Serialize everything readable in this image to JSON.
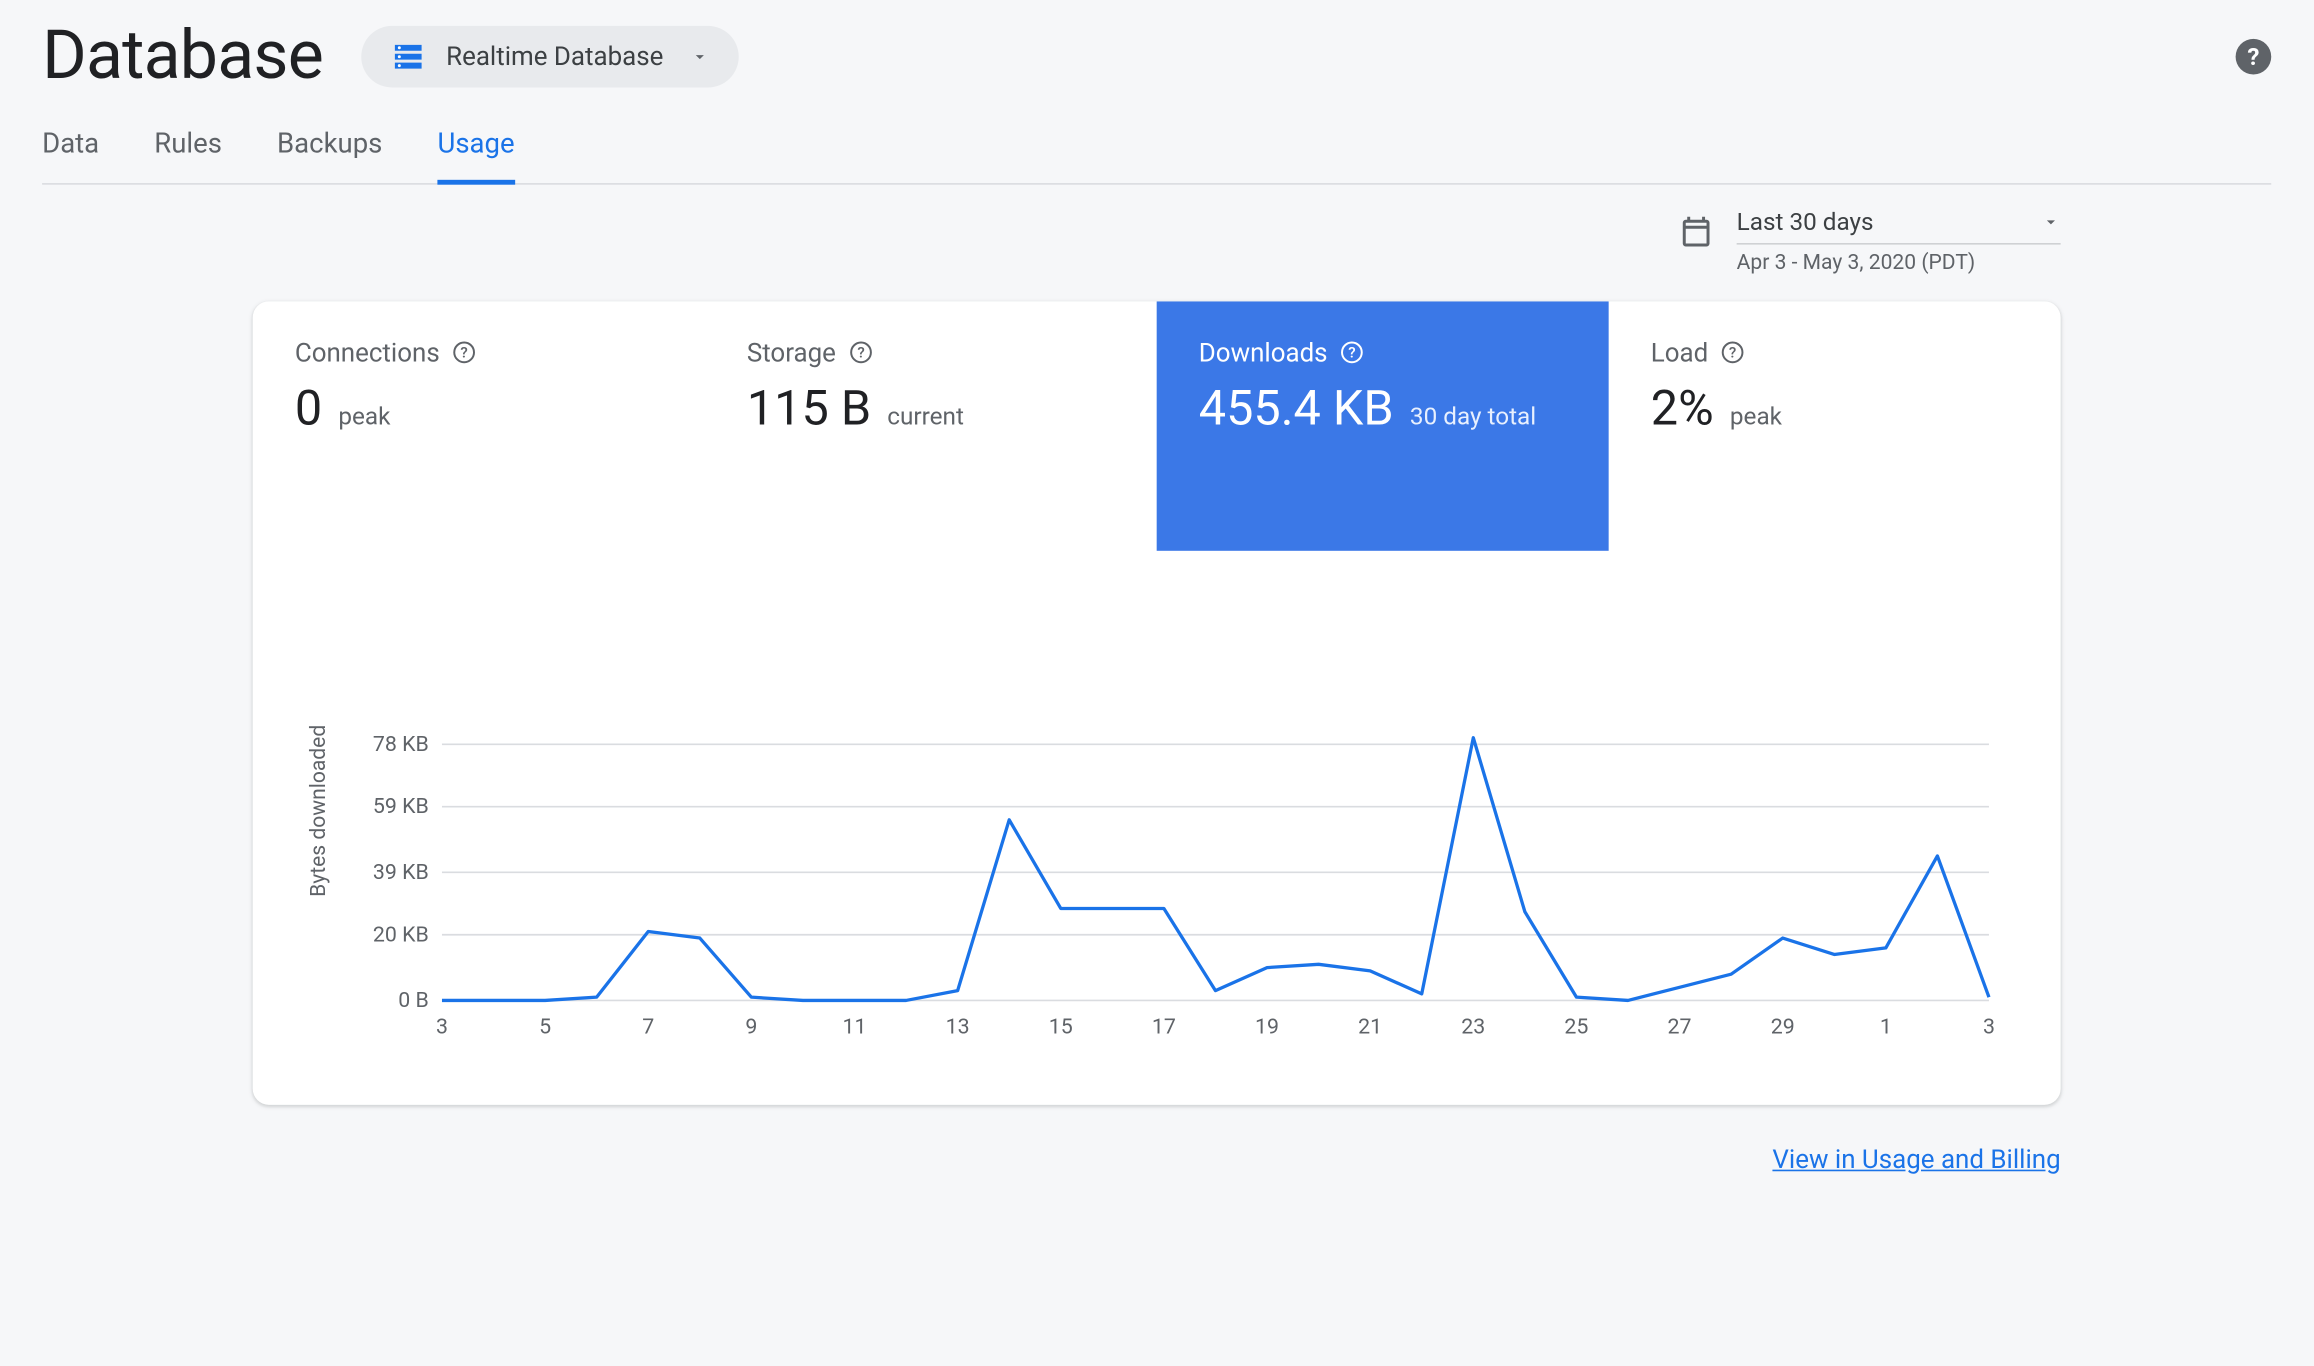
{
  "header": {
    "title": "Database",
    "selector_label": "Realtime Database"
  },
  "tabs": [
    "Data",
    "Rules",
    "Backups",
    "Usage"
  ],
  "active_tab": "Usage",
  "date_selector": {
    "label": "Last 30 days",
    "range": "Apr 3 - May 3, 2020 (PDT)"
  },
  "metrics": {
    "connections": {
      "label": "Connections",
      "value": "0",
      "suffix": "peak"
    },
    "storage": {
      "label": "Storage",
      "value": "115 B",
      "suffix": "current"
    },
    "downloads": {
      "label": "Downloads",
      "value": "455.4 KB",
      "suffix": "30 day total"
    },
    "load": {
      "label": "Load",
      "value": "2%",
      "suffix": "peak"
    }
  },
  "active_metric": "downloads",
  "chart_data": {
    "type": "line",
    "title": "",
    "ylabel": "Bytes downloaded",
    "xlabel": "",
    "ylim": [
      0,
      80
    ],
    "y_ticks": [
      "0 B",
      "20 KB",
      "39 KB",
      "59 KB",
      "78 KB"
    ],
    "x_tick_labels": [
      "3",
      "5",
      "7",
      "9",
      "11",
      "13",
      "15",
      "17",
      "19",
      "21",
      "23",
      "25",
      "27",
      "29",
      "1",
      "3"
    ],
    "series": [
      {
        "name": "Bytes downloaded",
        "color": "#1a73e8",
        "x": [
          3,
          4,
          5,
          6,
          7,
          8,
          9,
          10,
          11,
          12,
          13,
          14,
          15,
          16,
          17,
          18,
          19,
          20,
          21,
          22,
          23,
          24,
          25,
          26,
          27,
          28,
          29,
          30,
          1,
          2,
          3
        ],
        "values": [
          0,
          0,
          0,
          1,
          21,
          19,
          1,
          0,
          0,
          0,
          3,
          55,
          28,
          28,
          28,
          3,
          10,
          11,
          9,
          2,
          80,
          27,
          1,
          0,
          4,
          8,
          19,
          14,
          16,
          44,
          1
        ]
      }
    ]
  },
  "footer_link": "View in Usage and Billing"
}
